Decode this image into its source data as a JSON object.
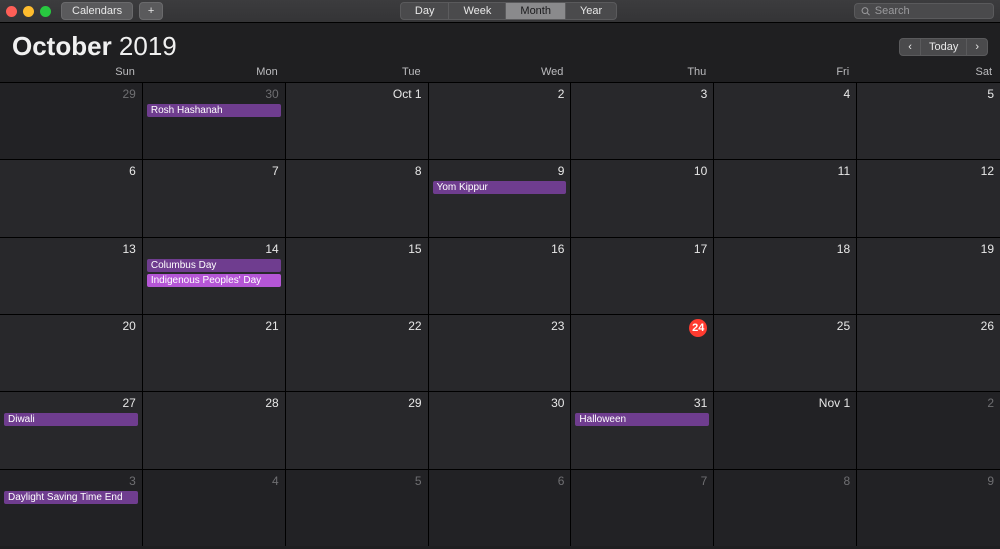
{
  "toolbar": {
    "calendars_label": "Calendars",
    "add_label": "+",
    "views": {
      "day": "Day",
      "week": "Week",
      "month": "Month",
      "year": "Year",
      "active": "month"
    },
    "search_placeholder": "Search"
  },
  "header": {
    "month": "October",
    "year": "2019",
    "today_label": "Today",
    "prev_glyph": "‹",
    "next_glyph": "›"
  },
  "dow": [
    "Sun",
    "Mon",
    "Tue",
    "Wed",
    "Thu",
    "Fri",
    "Sat"
  ],
  "cells": [
    {
      "n": "29",
      "out": true
    },
    {
      "n": "30",
      "out": true,
      "events": [
        {
          "t": "Rosh Hashanah",
          "c": "ev-purple"
        }
      ]
    },
    {
      "n": "1",
      "monthPrefix": "Oct"
    },
    {
      "n": "2"
    },
    {
      "n": "3"
    },
    {
      "n": "4"
    },
    {
      "n": "5"
    },
    {
      "n": "6"
    },
    {
      "n": "7"
    },
    {
      "n": "8"
    },
    {
      "n": "9",
      "events": [
        {
          "t": "Yom Kippur",
          "c": "ev-purple"
        }
      ]
    },
    {
      "n": "10"
    },
    {
      "n": "11"
    },
    {
      "n": "12"
    },
    {
      "n": "13"
    },
    {
      "n": "14",
      "events": [
        {
          "t": "Columbus Day",
          "c": "ev-purple"
        },
        {
          "t": "Indigenous Peoples' Day",
          "c": "ev-pink"
        }
      ]
    },
    {
      "n": "15"
    },
    {
      "n": "16"
    },
    {
      "n": "17"
    },
    {
      "n": "18"
    },
    {
      "n": "19"
    },
    {
      "n": "20"
    },
    {
      "n": "21"
    },
    {
      "n": "22"
    },
    {
      "n": "23"
    },
    {
      "n": "24",
      "today": true
    },
    {
      "n": "25"
    },
    {
      "n": "26"
    },
    {
      "n": "27",
      "events": [
        {
          "t": "Diwali",
          "c": "ev-purple"
        }
      ]
    },
    {
      "n": "28"
    },
    {
      "n": "29"
    },
    {
      "n": "30"
    },
    {
      "n": "31",
      "events": [
        {
          "t": "Halloween",
          "c": "ev-purple"
        }
      ]
    },
    {
      "n": "1",
      "out": true,
      "monthPrefix": "Nov"
    },
    {
      "n": "2",
      "out": true
    },
    {
      "n": "3",
      "out": true,
      "events": [
        {
          "t": "Daylight Saving Time End",
          "c": "ev-purple"
        }
      ]
    },
    {
      "n": "4",
      "out": true
    },
    {
      "n": "5",
      "out": true
    },
    {
      "n": "6",
      "out": true
    },
    {
      "n": "7",
      "out": true
    },
    {
      "n": "8",
      "out": true
    },
    {
      "n": "9",
      "out": true
    }
  ]
}
